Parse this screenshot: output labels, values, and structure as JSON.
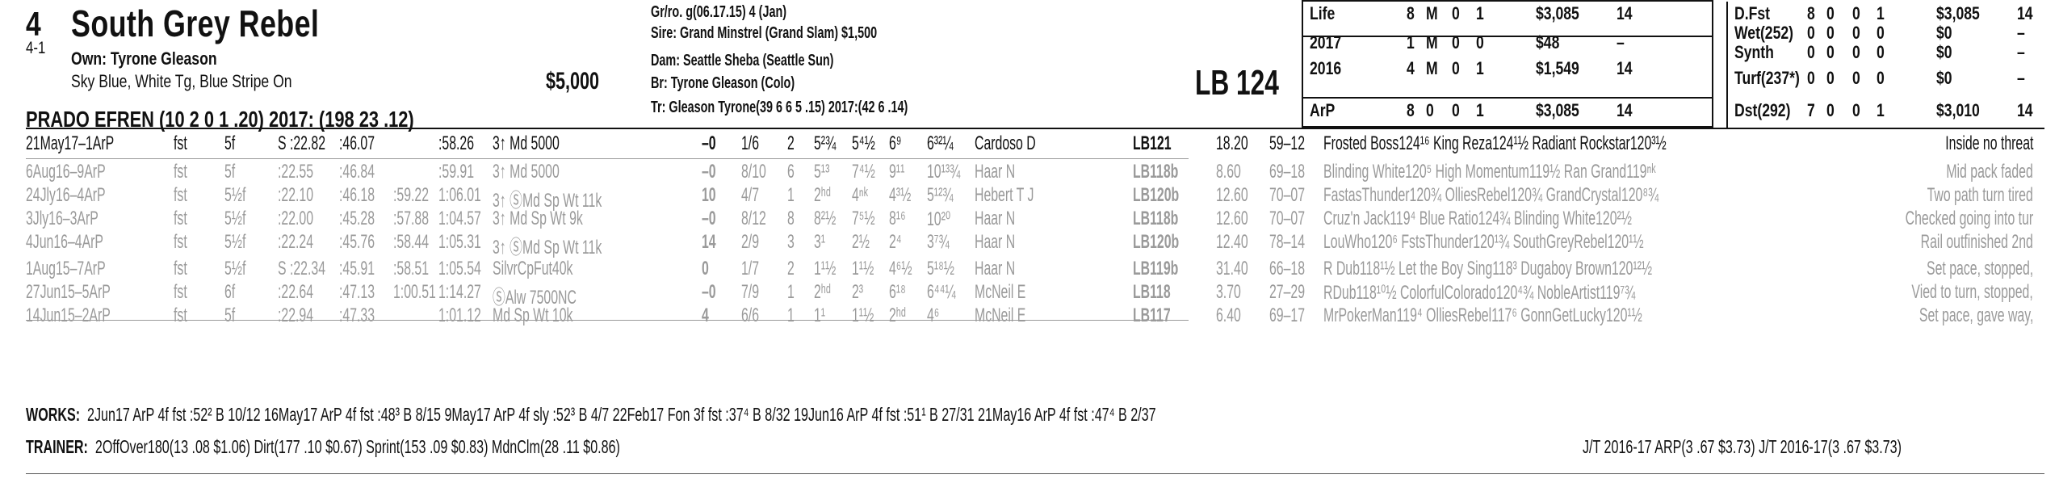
{
  "horse": {
    "program": "4",
    "odds": "4-1",
    "name": "South Grey Rebel",
    "owner": "Own: Tyrone Gleason",
    "silks": "Sky Blue, White Tg, Blue Stripe On",
    "claim_price": "$5,000",
    "jockey": "PRADO EFREN (10 2 0 1 .20) 2017: (198 23 .12)",
    "sex_age": "Gr/ro. g(06.17.15) 4 (Jan)",
    "sire": "Sire: Grand Minstrel (Grand Slam) $1,500",
    "dam": "Dam: Seattle Sheba (Seattle Sun)",
    "breeder": "Br:   Tyrone Gleason (Colo)",
    "trainer_line": "Tr:    Gleason Tyrone(39 6 6 5 .15)  2017:(42 6 .14)",
    "lasix_weight": "LB 124"
  },
  "record_left": [
    {
      "label": "Life",
      "st": "8",
      "w": "M",
      "p": "0",
      "s": "1",
      "earn": "$3,085",
      "spd": "14"
    },
    {
      "label": "2017",
      "st": "1",
      "w": "M",
      "p": "0",
      "s": "0",
      "earn": "$48",
      "spd": "–"
    },
    {
      "label": "2016",
      "st": "4",
      "w": "M",
      "p": "0",
      "s": "1",
      "earn": "$1,549",
      "spd": "14"
    },
    {
      "label": "ArP",
      "st": "8",
      "w": "0",
      "p": "0",
      "s": "1",
      "earn": "$3,085",
      "spd": "14"
    }
  ],
  "record_right": [
    {
      "label": "D.Fst",
      "st": "8",
      "w": "0",
      "p": "0",
      "s": "1",
      "earn": "$3,085",
      "spd": "14"
    },
    {
      "label": "Wet(252)",
      "st": "0",
      "w": "0",
      "p": "0",
      "s": "0",
      "earn": "$0",
      "spd": "–"
    },
    {
      "label": "Synth",
      "st": "0",
      "w": "0",
      "p": "0",
      "s": "0",
      "earn": "$0",
      "spd": "–"
    },
    {
      "label": "Turf(237*)",
      "st": "0",
      "w": "0",
      "p": "0",
      "s": "0",
      "earn": "$0",
      "spd": "–"
    },
    {
      "label": "Dst(292)",
      "st": "7",
      "w": "0",
      "p": "0",
      "s": "1",
      "earn": "$3,010",
      "spd": "14"
    }
  ],
  "past_performances": [
    {
      "date": "21May17–1ArP",
      "cond": "fst",
      "dist": "5f",
      "fr1": "S :22.82",
      "fr2": ":46.07",
      "fr3": "",
      "fin": ":58.26",
      "race": "3↑ Md 5000",
      "spd": "–0",
      "pp": "1/6",
      "st": "2",
      "c1": "5²¾",
      "c2": "5⁴½",
      "c3": "6⁹",
      "fn": "6³²¼",
      "jock": "Cardoso D",
      "wt": "LB121",
      "odds": "18.20",
      "sp": "59–12",
      "comp": "Frosted Boss124¹⁶ King Reza124¹½ Radiant Rockstar120³½",
      "comment": "Inside no threat",
      "gray": false
    },
    {
      "date": "6Aug16–9ArP",
      "cond": "fst",
      "dist": "5f",
      "fr1": ":22.55",
      "fr2": ":46.84",
      "fr3": "",
      "fin": ":59.91",
      "race": "3↑ Md 5000",
      "spd": "–0",
      "pp": "8/10",
      "st": "6",
      "c1": "5¹³",
      "c2": "7⁴½",
      "c3": "9¹¹",
      "fn": "10¹³¾",
      "jock": "Haar N",
      "wt": "LB118b",
      "odds": "8.60",
      "sp": "69–18",
      "comp": "Blinding White120⁵ High Momentum119½ Ran Grand119ⁿᵏ",
      "comment": "Mid pack faded",
      "gray": true
    },
    {
      "date": "24Jly16–4ArP",
      "cond": "fst",
      "dist": "5½f",
      "fr1": ":22.10",
      "fr2": ":46.18",
      "fr3": ":59.22",
      "fin": "1:06.01",
      "race": "3↑ ⓈMd Sp Wt 11k",
      "spd": "10",
      "pp": "4/7",
      "st": "1",
      "c1": "2ʰᵈ",
      "c2": "4ⁿᵏ",
      "c3": "4³½",
      "fn": "5¹²¾",
      "jock": "Hebert T J",
      "wt": "LB120b",
      "odds": "12.60",
      "sp": "70–07",
      "comp": "FastasThunder120¾ OlliesRebel120¾ GrandCrystal120⁸¾",
      "comment": "Two path turn tired",
      "gray": true
    },
    {
      "date": "3Jly16–3ArP",
      "cond": "fst",
      "dist": "5½f",
      "fr1": ":22.00",
      "fr2": ":45.28",
      "fr3": ":57.88",
      "fin": "1:04.57",
      "race": "3↑ Md Sp Wt 9k",
      "spd": "–0",
      "pp": "8/12",
      "st": "8",
      "c1": "8²½",
      "c2": "7⁵½",
      "c3": "8¹⁶",
      "fn": "10²⁰",
      "jock": "Haar N",
      "wt": "LB118b",
      "odds": "12.60",
      "sp": "70–07",
      "comp": "Cruz'n Jack119⁴ Blue Ratio124¾ Blinding White120²½",
      "comment": "Checked going into tur",
      "gray": true
    },
    {
      "date": "4Jun16–4ArP",
      "cond": "fst",
      "dist": "5½f",
      "fr1": ":22.24",
      "fr2": ":45.76",
      "fr3": ":58.44",
      "fin": "1:05.31",
      "race": "3↑ ⓈMd Sp Wt 11k",
      "spd": "14",
      "pp": "2/9",
      "st": "3",
      "c1": "3¹",
      "c2": "2½",
      "c3": "2⁴",
      "fn": "3⁷¾",
      "jock": "Haar N",
      "wt": "LB120b",
      "odds": "12.40",
      "sp": "78–14",
      "comp": "LouWho120⁶ FstsThunder120¹¾ SouthGreyRebel120¹½",
      "comment": "Rail outfinished 2nd",
      "gray": true
    },
    {
      "date": "1Aug15–7ArP",
      "cond": "fst",
      "dist": "5½f",
      "fr1": "S :22.34",
      "fr2": ":45.91",
      "fr3": ":58.51",
      "fin": "1:05.54",
      "race": "SilvrCpFut40k",
      "spd": "0",
      "pp": "1/7",
      "st": "2",
      "c1": "1¹½",
      "c2": "1¹½",
      "c3": "4⁶½",
      "fn": "5¹⁸½",
      "jock": "Haar N",
      "wt": "LB119b",
      "odds": "31.40",
      "sp": "66–18",
      "comp": "R Dub118¹½ Let the Boy Sing118³ Dugaboy Brown120¹²½",
      "comment": "Set pace, stopped,",
      "gray": true
    },
    {
      "date": "27Jun15–5ArP",
      "cond": "fst",
      "dist": "6f",
      "fr1": ":22.64",
      "fr2": ":47.13",
      "fr3": "1:00.51",
      "fin": "1:14.27",
      "race": "ⓈAlw 7500NC",
      "spd": "–0",
      "pp": "7/9",
      "st": "1",
      "c1": "2ʰᵈ",
      "c2": "2³",
      "c3": "6¹⁸",
      "fn": "6⁴⁴¼",
      "jock": "McNeil E",
      "wt": "LB118",
      "odds": "3.70",
      "sp": "27–29",
      "comp": "RDub118¹⁰½ ColorfulColorado120⁴¾ NobleArtist119⁷¾",
      "comment": "Vied to turn, stopped,",
      "gray": true
    },
    {
      "date": "14Jun15–2ArP",
      "cond": "fst",
      "dist": "5f",
      "fr1": ":22.94",
      "fr2": ":47.33",
      "fr3": "",
      "fin": "1:01.12",
      "race": "Md Sp Wt 10k",
      "spd": "4",
      "pp": "6/6",
      "st": "1",
      "c1": "1¹",
      "c2": "1¹½",
      "c3": "2ʰᵈ",
      "fn": "4⁶",
      "jock": "McNeil E",
      "wt": "LB117",
      "odds": "6.40",
      "sp": "69–17",
      "comp": "MrPokerMan119⁴ OlliesRebel117⁶ GonnGetLucky120¹½",
      "comment": "Set pace, gave way,",
      "gray": true
    }
  ],
  "works": {
    "label": "WORKS:",
    "text": "2Jun17 ArP 4f fst :52² B 10/12   16May17 ArP 4f fst :48³ B 8/15   9May17 ArP 4f sly :52³ B 4/7   22Feb17 Fon 3f fst :37⁴ B 8/32   19Jun16 ArP 4f fst :51¹ B 27/31   21May16 ArP 4f fst :47⁴ B 2/37"
  },
  "trainer": {
    "label": "TRAINER:",
    "text": "2OffOver180(13 .08 $1.06) Dirt(177 .10 $0.67) Sprint(153 .09 $0.83) MdnClm(28 .11 $0.86)",
    "jt": "J/T 2016-17 ARP(3 .67 $3.73)  J/T 2016-17(3 .67 $3.73)"
  }
}
